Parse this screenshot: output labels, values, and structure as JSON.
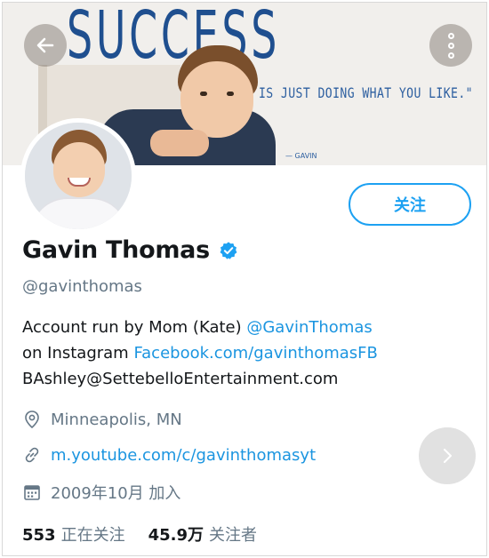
{
  "banner": {
    "title": "SUCCESS",
    "quote": "IS JUST DOING WHAT YOU LIKE.\"",
    "signature": "— GAVIN"
  },
  "navigation": {
    "back_icon": "arrow-left-icon",
    "more_icon": "more-vertical-icon",
    "next_icon": "chevron-right-icon"
  },
  "profile": {
    "name": "Gavin Thomas",
    "verified_icon": "verified-badge-icon",
    "handle": "@gavinthomas",
    "follow_label": "关注",
    "bio": {
      "line1_text": "Account run by Mom (Kate) ",
      "line1_link": "@GavinThomas",
      "line2_text": "on Instagram ",
      "line2_link": "Facebook.com/gavinthomasFB",
      "line3_text": "BAshley@SettebelloEntertainment.com"
    },
    "location": "Minneapolis, MN",
    "website": "m.youtube.com/c/gavinthomasyt",
    "joined": "2009年10月 加入",
    "following_count": "553",
    "following_label": "正在关注",
    "followers_count": "45.9万",
    "followers_label": "关注者"
  },
  "colors": {
    "accent": "#1da1f2",
    "link": "#1b95e0",
    "secondary_text": "#657786",
    "primary_text": "#14171a"
  }
}
